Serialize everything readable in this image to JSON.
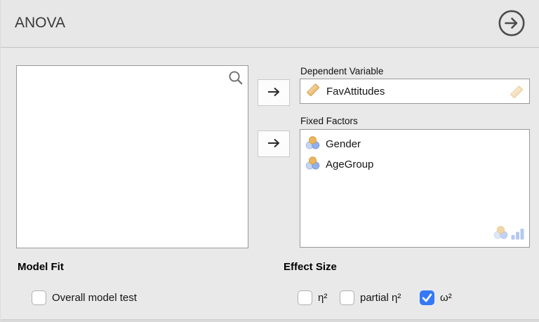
{
  "panel": {
    "title": "ANOVA"
  },
  "source_list": {
    "items": []
  },
  "fields": {
    "dependent": {
      "label": "Dependent Variable",
      "value": "FavAttitudes",
      "type_icon": "continuous-ruler-icon"
    },
    "fixed_factors": {
      "label": "Fixed Factors",
      "items": [
        {
          "name": "Gender",
          "type_icon": "nominal-icon"
        },
        {
          "name": "AgeGroup",
          "type_icon": "nominal-icon"
        }
      ],
      "allowed_type_icons": [
        "nominal-icon",
        "ordinal-bars-icon"
      ]
    }
  },
  "sections": {
    "model_fit": {
      "heading": "Model Fit",
      "options": [
        {
          "label": "Overall model test",
          "checked": false
        }
      ]
    },
    "effect_size": {
      "heading": "Effect Size",
      "options": [
        {
          "label": "η²",
          "checked": false
        },
        {
          "label": "partial η²",
          "checked": false
        },
        {
          "label": "ω²",
          "checked": true
        }
      ]
    }
  },
  "colors": {
    "accent_blue": "#3478f6",
    "panel_bg": "#e9e9e9",
    "box_border": "#999999",
    "nominal_orange": "#e9b55e",
    "nominal_blue": "#92b0ea",
    "ruler_tan": "#eec27e"
  }
}
